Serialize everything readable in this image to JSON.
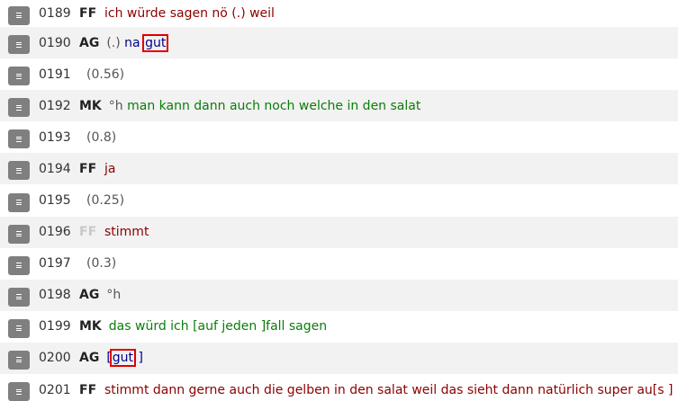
{
  "rows": [
    {
      "num": "0189",
      "speaker": "FF",
      "parts": [
        {
          "t": "ich würde sagen nö (.) weil",
          "c": "red"
        }
      ]
    },
    {
      "num": "0190",
      "speaker": "AG",
      "parts": [
        {
          "t": "(.) ",
          "c": "grey"
        },
        {
          "t": "na ",
          "c": "blue"
        },
        {
          "t": "gut",
          "c": "blue",
          "boxed": true
        }
      ]
    },
    {
      "num": "0191",
      "pause": "(0.56)"
    },
    {
      "num": "0192",
      "speaker": "MK",
      "parts": [
        {
          "t": "°h ",
          "c": "grey"
        },
        {
          "t": "man kann dann auch noch welche in den salat",
          "c": "green"
        }
      ]
    },
    {
      "num": "0193",
      "pause": "(0.8)"
    },
    {
      "num": "0194",
      "speaker": "FF",
      "parts": [
        {
          "t": "ja",
          "c": "red"
        }
      ]
    },
    {
      "num": "0195",
      "pause": "(0.25)"
    },
    {
      "num": "0196",
      "speaker": "FF",
      "speaker_faded": true,
      "parts": [
        {
          "t": "stimmt",
          "c": "red"
        }
      ]
    },
    {
      "num": "0197",
      "pause": "(0.3)"
    },
    {
      "num": "0198",
      "speaker": "AG",
      "parts": [
        {
          "t": "°h",
          "c": "grey"
        }
      ]
    },
    {
      "num": "0199",
      "speaker": "MK",
      "parts": [
        {
          "t": "das würd ich [auf jeden ]fall sagen",
          "c": "green"
        }
      ]
    },
    {
      "num": "0200",
      "speaker": "AG",
      "parts": [
        {
          "t": "[",
          "c": "blue"
        },
        {
          "t": "gut",
          "c": "blue",
          "boxed": true
        },
        {
          "t": " ]",
          "c": "blue"
        }
      ]
    },
    {
      "num": "0201",
      "speaker": "FF",
      "parts": [
        {
          "t": "stimmt dann gerne auch die gelben in den salat weil das sieht dann natürlich super au[s ]",
          "c": "red"
        }
      ]
    }
  ],
  "colors": {
    "red": "#8b0000",
    "blue": "#00008b",
    "green": "#0a7d0a",
    "grey": "#555555",
    "highlight_box": "#e00000"
  },
  "icons": {
    "row_menu": "menu-icon"
  }
}
